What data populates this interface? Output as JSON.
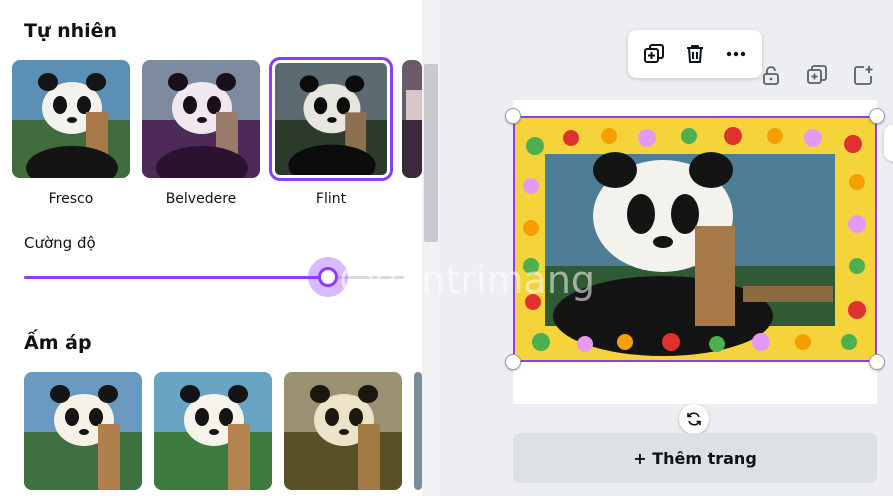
{
  "filters": {
    "natural": {
      "title": "Tự nhiên",
      "items": [
        {
          "label": "Fresco",
          "tone": "natural"
        },
        {
          "label": "Belvedere",
          "tone": "purple"
        },
        {
          "label": "Flint",
          "tone": "dark",
          "selected": true
        }
      ]
    },
    "intensity": {
      "label": "Cường độ",
      "value": 0.8
    },
    "warm": {
      "title": "Ấm áp",
      "items": [
        {
          "tone": "warm1"
        },
        {
          "tone": "warm2"
        },
        {
          "tone": "warm3"
        }
      ]
    }
  },
  "toolbar": {
    "icons": [
      "duplicate-icon",
      "trash-icon",
      "more-icon"
    ]
  },
  "page_actions": {
    "icons": [
      "lock-icon",
      "duplicate-page-icon",
      "add-page-icon"
    ]
  },
  "canvas": {
    "add_page_label": "+ Thêm trang"
  },
  "watermark": {
    "text": "uantrimang"
  },
  "colors": {
    "accent": "#8b3dff",
    "frame_yellow": "#f5d33b"
  }
}
